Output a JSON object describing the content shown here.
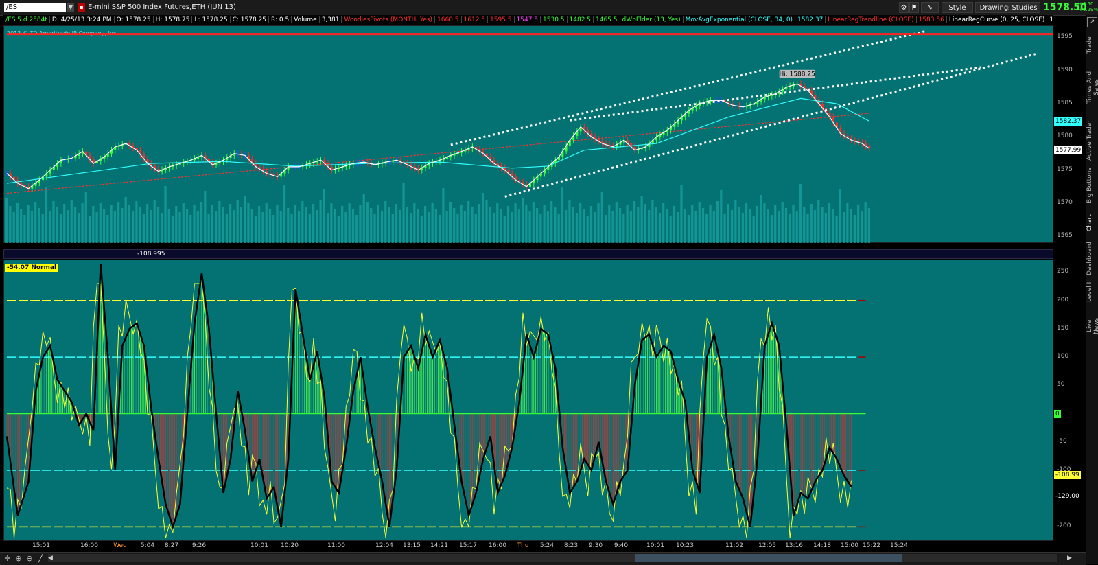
{
  "toolbar": {
    "symbol": "/ES",
    "title": "E-mini S&P 500 Index Futures,ETH (JUN 13)",
    "style_label": "Style",
    "drawings_label": "Drawings",
    "studies_label": "Studies",
    "last_price": "1578.50",
    "change_abs": "+6.50",
    "change_pct": "+0.29%"
  },
  "info_bar": [
    {
      "text": "/ES 5 d 2584t",
      "color": "#3bff3b"
    },
    {
      "text": "D: 4/25/13 3:24 PM",
      "color": "#ffffff"
    },
    {
      "text": "O: 1578.25",
      "color": "#ffffff"
    },
    {
      "text": "H: 1578.75",
      "color": "#ffffff"
    },
    {
      "text": "L: 1578.25",
      "color": "#ffffff"
    },
    {
      "text": "C: 1578.25",
      "color": "#ffffff"
    },
    {
      "text": "R: 0.5",
      "color": "#ffffff"
    },
    {
      "text": "Volume",
      "color": "#ffffff"
    },
    {
      "text": "3,381",
      "color": "#ffffff"
    },
    {
      "text": "WoodiesPivots (MONTH, Yes)",
      "color": "#ff3030"
    },
    {
      "text": "1660.5",
      "color": "#ff3030"
    },
    {
      "text": "1612.5",
      "color": "#ff3030"
    },
    {
      "text": "1595.5",
      "color": "#ff3030"
    },
    {
      "text": "1547.5",
      "color": "#ff44ff"
    },
    {
      "text": "1530.5",
      "color": "#3bff3b"
    },
    {
      "text": "1482.5",
      "color": "#3bff3b"
    },
    {
      "text": "1465.5",
      "color": "#3bff3b"
    },
    {
      "text": "dWbElder (13, Yes)",
      "color": "#3bff3b"
    },
    {
      "text": "MovAvgExponential (CLOSE, 34, 0)",
      "color": "#33ffff"
    },
    {
      "text": "1582.37",
      "color": "#33ffff"
    },
    {
      "text": "LinearRegTrendline (CLOSE)",
      "color": "#ff3030"
    },
    {
      "text": "1583.56",
      "color": "#ff3030"
    },
    {
      "text": "LinearRegCurve (0, 25, CLOSE)",
      "color": "#ffffff"
    },
    {
      "text": "1577.99",
      "color": "#ffffff"
    }
  ],
  "copyright": "2013 © TD Ameritrade IP Company, Inc.",
  "hi_label": "Hi: 1588.25",
  "osc_header_value": "-108.995",
  "osc_badge": "-54.07 Normal",
  "price_axis_ticks": [
    "1595",
    "1590",
    "1585",
    "1580",
    "1575",
    "1570",
    "1565"
  ],
  "price_markers": {
    "ema": "1582.37",
    "regcurve": "1577.99"
  },
  "osc_axis_ticks": [
    "250",
    "200",
    "150",
    "100",
    "50",
    "0",
    "-50",
    "-100",
    "-150",
    "-200"
  ],
  "osc_markers": {
    "zero": "0",
    "yellow": "-108.99",
    "black": "-129.00"
  },
  "time_labels": [
    "15:01",
    "16:00",
    "Wed",
    "5:04",
    "8:27",
    "9:26",
    "10:01",
    "10:20",
    "11:00",
    "12:04",
    "13:15",
    "14:21",
    "15:17",
    "16:00",
    "Thu",
    "5:24",
    "8:23",
    "9:30",
    "9:40",
    "10:01",
    "10:23",
    "11:02",
    "12:05",
    "13:16",
    "14:18",
    "15:00",
    "15:22",
    "15:24"
  ],
  "side_tabs": [
    "Trade",
    "Times And Sales",
    "Active Trader",
    "Big Buttons",
    "Chart",
    "Dashboard",
    "Level II",
    "Live News"
  ],
  "colors": {
    "pane_bg": "#047272",
    "up": "#3bff3b",
    "down": "#ff2a2a",
    "neutral": "#2a4cff",
    "ema": "#33ffff",
    "reg_curve": "#ffffff",
    "trend": "#ff3030",
    "cci_line": "#000000",
    "turbo_line": "#ffff33"
  },
  "chart_data": {
    "type": "line",
    "price": {
      "close_points": [
        [
          0,
          1574.5
        ],
        [
          3,
          1573
        ],
        [
          6,
          1572.2
        ],
        [
          9,
          1573.5
        ],
        [
          12,
          1575
        ],
        [
          15,
          1576.5
        ],
        [
          18,
          1576.8
        ],
        [
          21,
          1577.8
        ],
        [
          24,
          1576
        ],
        [
          27,
          1577
        ],
        [
          30,
          1578.5
        ],
        [
          33,
          1579
        ],
        [
          36,
          1578
        ],
        [
          39,
          1576
        ],
        [
          42,
          1574.8
        ],
        [
          45,
          1575.5
        ],
        [
          48,
          1576
        ],
        [
          51,
          1576.5
        ],
        [
          54,
          1577.2
        ],
        [
          57,
          1575.8
        ],
        [
          60,
          1576.5
        ],
        [
          63,
          1577.5
        ],
        [
          66,
          1577.2
        ],
        [
          69,
          1575.5
        ],
        [
          72,
          1574.5
        ],
        [
          75,
          1574
        ],
        [
          78,
          1575.5
        ],
        [
          81,
          1575.5
        ],
        [
          84,
          1576
        ],
        [
          87,
          1576.5
        ],
        [
          90,
          1575
        ],
        [
          93,
          1575.5
        ],
        [
          96,
          1576
        ],
        [
          99,
          1576.2
        ],
        [
          102,
          1575.8
        ],
        [
          105,
          1576.2
        ],
        [
          108,
          1576.5
        ],
        [
          111,
          1575.8
        ],
        [
          114,
          1575
        ],
        [
          117,
          1576
        ],
        [
          120,
          1576.5
        ],
        [
          123,
          1577.2
        ],
        [
          126,
          1577.8
        ],
        [
          129,
          1578.5
        ],
        [
          132,
          1577.5
        ],
        [
          135,
          1576
        ],
        [
          138,
          1575
        ],
        [
          141,
          1573.5
        ],
        [
          144,
          1572.5
        ],
        [
          147,
          1574
        ],
        [
          150,
          1575.5
        ],
        [
          153,
          1577
        ],
        [
          156,
          1579.5
        ],
        [
          159,
          1581.5
        ],
        [
          162,
          1580
        ],
        [
          165,
          1579
        ],
        [
          168,
          1578.5
        ],
        [
          171,
          1579.5
        ],
        [
          174,
          1578
        ],
        [
          177,
          1578.5
        ],
        [
          180,
          1580
        ],
        [
          183,
          1581
        ],
        [
          186,
          1582.5
        ],
        [
          189,
          1584
        ],
        [
          192,
          1585
        ],
        [
          195,
          1585.5
        ],
        [
          198,
          1585.5
        ],
        [
          201,
          1584.8
        ],
        [
          204,
          1584.5
        ],
        [
          207,
          1585
        ],
        [
          210,
          1586
        ],
        [
          213,
          1586.5
        ],
        [
          216,
          1587.5
        ],
        [
          219,
          1588
        ],
        [
          222,
          1587
        ],
        [
          225,
          1585
        ],
        [
          228,
          1583
        ],
        [
          231,
          1580.5
        ],
        [
          234,
          1579.5
        ],
        [
          237,
          1579
        ],
        [
          239,
          1578.25
        ]
      ],
      "ema_34": [
        [
          0,
          1573
        ],
        [
          20,
          1574.5
        ],
        [
          40,
          1576
        ],
        [
          60,
          1576.3
        ],
        [
          80,
          1575.6
        ],
        [
          100,
          1576
        ],
        [
          120,
          1576.2
        ],
        [
          140,
          1575.3
        ],
        [
          150,
          1575.6
        ],
        [
          160,
          1578
        ],
        [
          180,
          1579
        ],
        [
          200,
          1583
        ],
        [
          220,
          1585.8
        ],
        [
          230,
          1585
        ],
        [
          239,
          1582.37
        ]
      ],
      "linreg_trend": [
        [
          0,
          1571.5
        ],
        [
          239,
          1583.56
        ]
      ],
      "channel_upper": [
        [
          123,
          1578.8
        ],
        [
          255,
          1596
        ]
      ],
      "channel_lower": [
        [
          138,
          1571
        ],
        [
          285,
          1592.5
        ]
      ],
      "channel_mid": [
        [
          156,
          1582.5
        ],
        [
          270,
          1590.5
        ]
      ],
      "volume_baseline": 1564.5,
      "high": 1588.25,
      "y_range": [
        1564,
        1596.5
      ]
    },
    "oscillator": {
      "cci_points": [
        [
          0,
          -40
        ],
        [
          3,
          -180
        ],
        [
          6,
          -120
        ],
        [
          8,
          40
        ],
        [
          10,
          100
        ],
        [
          12,
          120
        ],
        [
          14,
          60
        ],
        [
          16,
          40
        ],
        [
          18,
          20
        ],
        [
          20,
          -20
        ],
        [
          22,
          0
        ],
        [
          24,
          -30
        ],
        [
          26,
          265
        ],
        [
          28,
          100
        ],
        [
          30,
          -100
        ],
        [
          32,
          120
        ],
        [
          34,
          150
        ],
        [
          36,
          160
        ],
        [
          38,
          120
        ],
        [
          40,
          10
        ],
        [
          42,
          -80
        ],
        [
          44,
          -160
        ],
        [
          46,
          -200
        ],
        [
          48,
          -160
        ],
        [
          50,
          0
        ],
        [
          52,
          160
        ],
        [
          54,
          248
        ],
        [
          56,
          150
        ],
        [
          58,
          0
        ],
        [
          60,
          -140
        ],
        [
          62,
          -80
        ],
        [
          64,
          40
        ],
        [
          66,
          -30
        ],
        [
          68,
          -120
        ],
        [
          70,
          -80
        ],
        [
          72,
          -150
        ],
        [
          74,
          -130
        ],
        [
          76,
          -200
        ],
        [
          78,
          -80
        ],
        [
          80,
          220
        ],
        [
          82,
          140
        ],
        [
          84,
          60
        ],
        [
          86,
          110
        ],
        [
          88,
          30
        ],
        [
          90,
          -120
        ],
        [
          92,
          -140
        ],
        [
          94,
          -60
        ],
        [
          96,
          40
        ],
        [
          98,
          100
        ],
        [
          100,
          10
        ],
        [
          102,
          -60
        ],
        [
          104,
          -120
        ],
        [
          106,
          -200
        ],
        [
          108,
          -100
        ],
        [
          110,
          100
        ],
        [
          112,
          120
        ],
        [
          114,
          80
        ],
        [
          116,
          140
        ],
        [
          118,
          100
        ],
        [
          120,
          130
        ],
        [
          122,
          80
        ],
        [
          124,
          -20
        ],
        [
          126,
          -120
        ],
        [
          128,
          -180
        ],
        [
          130,
          -140
        ],
        [
          132,
          -80
        ],
        [
          134,
          -40
        ],
        [
          136,
          -140
        ],
        [
          138,
          -110
        ],
        [
          140,
          -60
        ],
        [
          142,
          20
        ],
        [
          144,
          140
        ],
        [
          146,
          100
        ],
        [
          148,
          150
        ],
        [
          150,
          140
        ],
        [
          152,
          80
        ],
        [
          154,
          -60
        ],
        [
          156,
          -140
        ],
        [
          158,
          -120
        ],
        [
          160,
          -80
        ],
        [
          162,
          -100
        ],
        [
          164,
          -50
        ],
        [
          166,
          -120
        ],
        [
          168,
          -160
        ],
        [
          170,
          -120
        ],
        [
          172,
          -100
        ],
        [
          174,
          50
        ],
        [
          176,
          130
        ],
        [
          178,
          140
        ],
        [
          180,
          100
        ],
        [
          182,
          120
        ],
        [
          184,
          110
        ],
        [
          186,
          60
        ],
        [
          188,
          20
        ],
        [
          190,
          -100
        ],
        [
          192,
          -140
        ],
        [
          194,
          100
        ],
        [
          196,
          140
        ],
        [
          198,
          80
        ],
        [
          200,
          -40
        ],
        [
          202,
          -120
        ],
        [
          204,
          -150
        ],
        [
          206,
          -200
        ],
        [
          208,
          -80
        ],
        [
          210,
          120
        ],
        [
          212,
          160
        ],
        [
          214,
          120
        ],
        [
          216,
          -20
        ],
        [
          218,
          -180
        ],
        [
          220,
          -140
        ],
        [
          222,
          -150
        ],
        [
          224,
          -120
        ],
        [
          226,
          -100
        ],
        [
          228,
          -60
        ],
        [
          230,
          -80
        ],
        [
          232,
          -110
        ],
        [
          234,
          -129
        ]
      ],
      "zero": 0,
      "levels": [
        200,
        100,
        -100,
        -200
      ],
      "y_range": [
        -225,
        270
      ]
    },
    "x_range": [
      0,
      290
    ]
  }
}
